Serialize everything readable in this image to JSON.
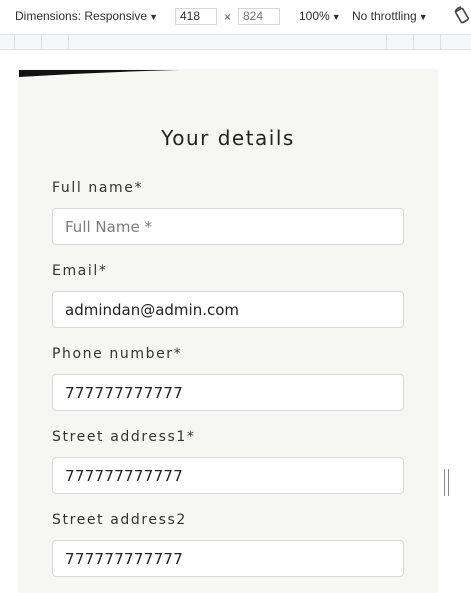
{
  "devtools": {
    "dimensions_label": "Dimensions: Responsive",
    "width": "418",
    "height_placeholder": "824",
    "times": "×",
    "zoom": "100%",
    "throttling": "No throttling"
  },
  "form": {
    "title": "Your details",
    "fields": [
      {
        "label": "Full name*",
        "value": "",
        "placeholder": "Full Name *"
      },
      {
        "label": "Email*",
        "value": "admindan@admin.com",
        "placeholder": ""
      },
      {
        "label": "Phone number*",
        "value": "777777777777",
        "placeholder": ""
      },
      {
        "label": "Street address1*",
        "value": "777777777777",
        "placeholder": ""
      },
      {
        "label": "Street address2",
        "value": "777777777777",
        "placeholder": ""
      }
    ]
  }
}
